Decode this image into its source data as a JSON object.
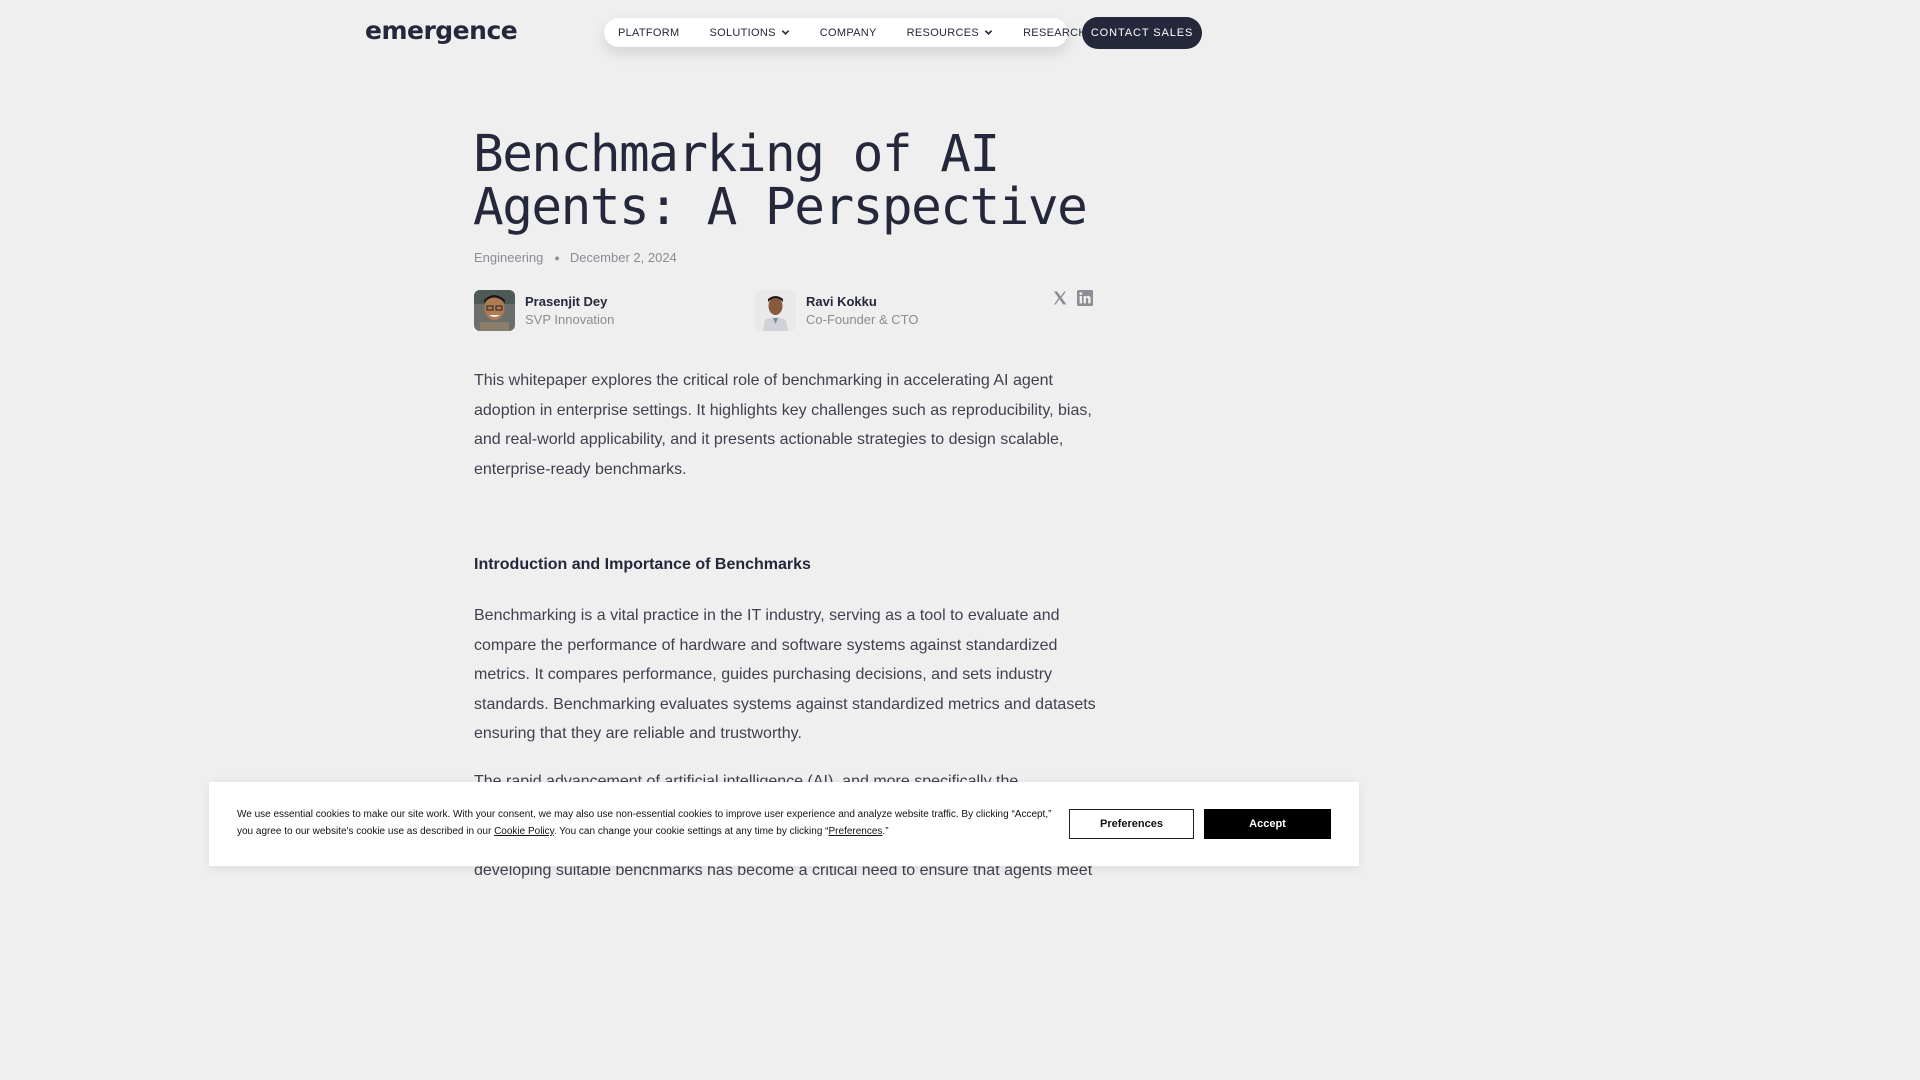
{
  "header": {
    "logo": "emergence",
    "nav": [
      {
        "label": "PLATFORM",
        "has_dropdown": false
      },
      {
        "label": "SOLUTIONS",
        "has_dropdown": true
      },
      {
        "label": "COMPANY",
        "has_dropdown": false
      },
      {
        "label": "RESOURCES",
        "has_dropdown": true
      },
      {
        "label": "RESEARCH",
        "has_dropdown": true
      }
    ],
    "contact_label": "CONTACT SALES"
  },
  "article": {
    "title": "Benchmarking of AI Agents: A Perspective",
    "category": "Engineering",
    "date": "December 2, 2024",
    "authors": [
      {
        "name": "Prasenjit Dey",
        "role": "SVP Innovation"
      },
      {
        "name": "Ravi Kokku",
        "role": "Co-Founder & CTO"
      }
    ],
    "social": [
      "x-icon",
      "linkedin-icon"
    ],
    "intro": "This whitepaper explores the critical role of benchmarking in accelerating AI agent adoption in enterprise settings. It highlights key challenges such as reproducibility, bias, and real-world applicability, and it presents actionable strategies to design scalable, enterprise-ready benchmarks.",
    "section_heading": "Introduction and Importance of Benchmarks",
    "paragraph1": "Benchmarking is a vital practice in the IT industry, serving as a tool to evaluate and compare the performance of hardware and software systems against standardized metrics. It compares performance, guides purchasing decisions, and sets industry standards. Benchmarking evaluates systems against standardized metrics and datasets ensuring that they are reliable and trustworthy.",
    "paragraph2_partial": "The rapid advancement of artificial intelligence (AI), and more specifically the",
    "paragraph2_tail": "developing suitable benchmarks has become a critical need to ensure that agents meet"
  },
  "cookie": {
    "text_1": "We use essential cookies to make our site work. With your consent, we may also use non-essential cookies to improve user experience and analyze website traffic. By clicking “Accept,” you agree to our website's cookie use as described in our ",
    "policy_link": "Cookie Policy",
    "text_2": ". You can change your cookie settings at any time by clicking “",
    "pref_link": "Preferences",
    "text_3": ".”",
    "preferences_button": "Preferences",
    "accept_button": "Accept"
  },
  "colors": {
    "background": "#efefef",
    "text_dark": "#25273a",
    "text_muted": "#8b8c94",
    "button_dark": "#25273a",
    "accept_bg": "#000000"
  }
}
